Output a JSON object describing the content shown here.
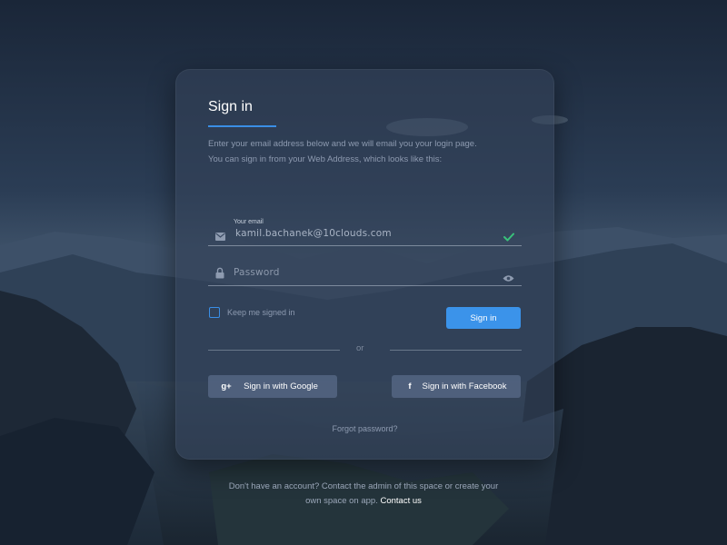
{
  "signin": {
    "title": "Sign in",
    "description_lines": [
      "Enter your email address below and we will email you your login page.",
      "You can sign in from your Web Address, which looks like this:"
    ],
    "email": {
      "label": "Your email",
      "value": "kamil.bachanek@10clouds.com",
      "icon": "envelope-icon",
      "status_icon": "checkmark-icon"
    },
    "password": {
      "placeholder": "Password",
      "icon": "lock-icon",
      "toggle_icon": "eye-icon"
    },
    "keep_signed_in": "Keep me signed in",
    "submit_label": "Sign in",
    "divider_text": "or",
    "google": {
      "icon_text": "g+",
      "label": "Sign in with Google"
    },
    "facebook": {
      "icon_text": "f",
      "label": "Sign in with Facebook"
    },
    "forgot_password": "Forgot password?"
  },
  "footer": {
    "line1": "Don't have an account? Contact the admin of this space or create your",
    "line2": "own space on app.",
    "contact_link": "Contact us"
  },
  "colors": {
    "accent": "#3b93ea",
    "valid": "#39c27b"
  }
}
